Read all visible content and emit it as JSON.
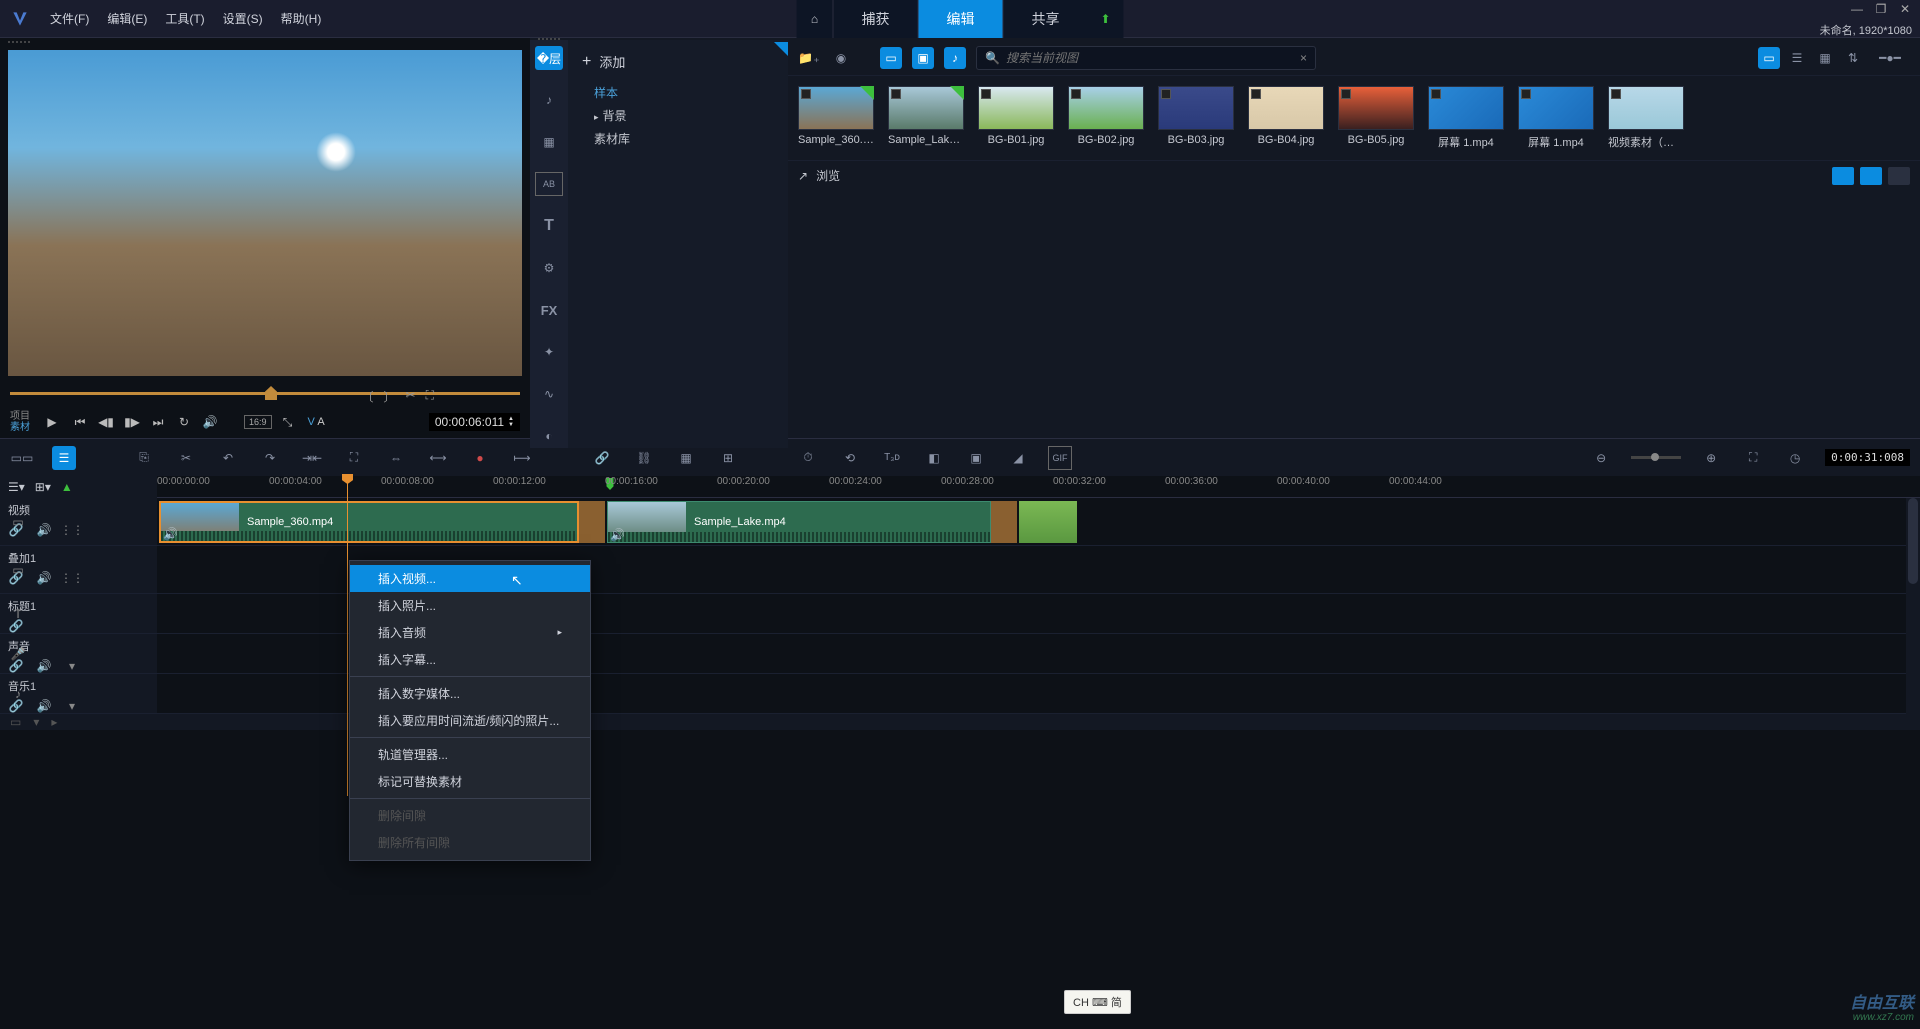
{
  "menubar": {
    "items": [
      "文件(F)",
      "编辑(E)",
      "工具(T)",
      "设置(S)",
      "帮助(H)"
    ]
  },
  "tabs": {
    "capture": "捕获",
    "edit": "编辑",
    "share": "共享"
  },
  "project_info": "未命名, 1920*1080",
  "preview": {
    "source_label_top": "项目",
    "source_label_bottom": "素材",
    "timecode": "00:00:06:011",
    "aspect": "16:9",
    "va": {
      "v": "V",
      "a": "A"
    }
  },
  "library": {
    "add_label": "添加",
    "tree": {
      "sample": "样本",
      "background": "背景",
      "library": "素材库"
    },
    "search_placeholder": "搜索当前视图",
    "thumbs": [
      {
        "label": "Sample_360.m...",
        "checked": true,
        "bg": "linear-gradient(180deg,#5ba8d4,#8a7356)"
      },
      {
        "label": "Sample_Lake...",
        "checked": true,
        "bg": "linear-gradient(180deg,#a8c8d8,#5a7a6a)"
      },
      {
        "label": "BG-B01.jpg",
        "checked": false,
        "bg": "linear-gradient(180deg,#d8e8f0,#8ab85a)"
      },
      {
        "label": "BG-B02.jpg",
        "checked": false,
        "bg": "linear-gradient(180deg,#a8d0e8,#6ab050)"
      },
      {
        "label": "BG-B03.jpg",
        "checked": false,
        "bg": "linear-gradient(180deg,#3a4a8a,#2a3a7a)"
      },
      {
        "label": "BG-B04.jpg",
        "checked": false,
        "bg": "linear-gradient(180deg,#e8d8b8,#d8c8a8)"
      },
      {
        "label": "BG-B05.jpg",
        "checked": false,
        "bg": "linear-gradient(180deg,#e8603a,#3a2020)"
      },
      {
        "label": "屏幕 1.mp4",
        "checked": false,
        "bg": "linear-gradient(135deg,#2a8ad8,#1a6ab8)"
      },
      {
        "label": "屏幕 1.mp4",
        "checked": false,
        "bg": "linear-gradient(135deg,#2a8ad8,#1a6ab8)"
      },
      {
        "label": "视频素材（总）...",
        "checked": false,
        "bg": "linear-gradient(180deg,#b8d8e8,#9ac8d8)"
      }
    ],
    "browse_label": "浏览"
  },
  "timeline_toolbar": {
    "timecode": "0:00:31:008"
  },
  "ruler": {
    "ticks": [
      "00:00:00:00",
      "00:00:04:00",
      "00:00:08:00",
      "00:00:12:00",
      "00:00:16:00",
      "00:00:20:00",
      "00:00:24:00",
      "00:00:28:00",
      "00:00:32:00",
      "00:00:36:00",
      "00:00:40:00",
      "00:00:44:00"
    ]
  },
  "tracks": {
    "video": "视频",
    "overlay1": "叠加1",
    "title1": "标题1",
    "voice": "声音",
    "music1": "音乐1"
  },
  "clips": {
    "clip1": "Sample_360.mp4",
    "clip2": "Sample_Lake.mp4"
  },
  "context_menu": {
    "insert_video": "插入视频...",
    "insert_photo": "插入照片...",
    "insert_audio": "插入音频",
    "insert_subtitle": "插入字幕...",
    "insert_digital": "插入数字媒体...",
    "insert_timelapse": "插入要应用时间流逝/频闪的照片...",
    "track_manager": "轨道管理器...",
    "mark_replaceable": "标记可替换素材",
    "delete_gap": "删除间隙",
    "delete_all_gaps": "删除所有间隙"
  },
  "ime": {
    "label": "CH ⌨ 简"
  },
  "watermark": {
    "top": "自由互联",
    "bottom": "www.xz7.com"
  }
}
